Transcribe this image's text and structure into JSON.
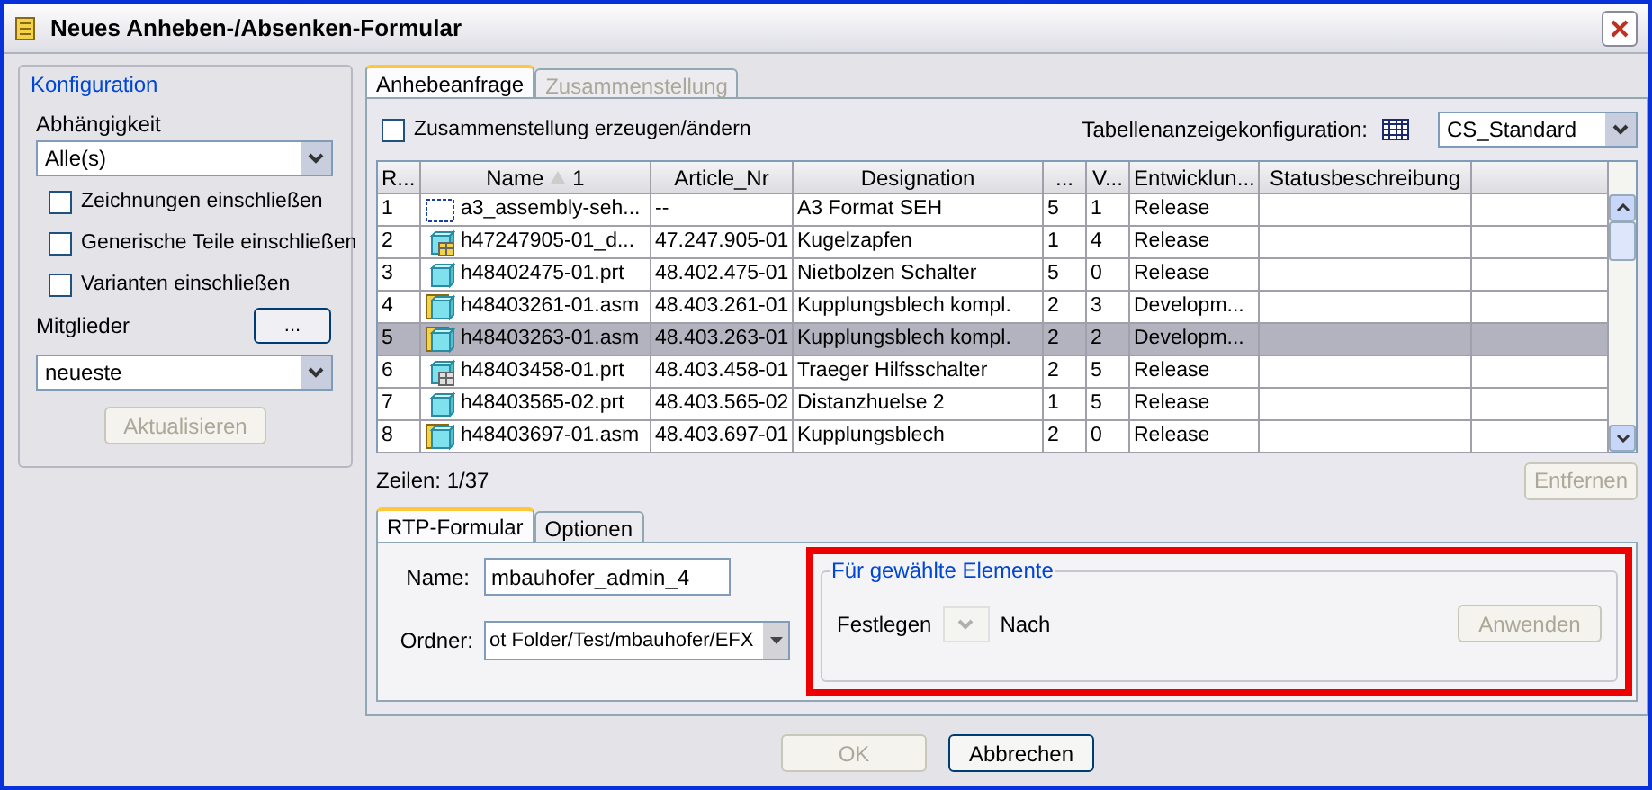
{
  "window": {
    "title": "Neues Anheben-/Absenken-Formular"
  },
  "configuration": {
    "title": "Konfiguration",
    "dependency_label": "Abhängigkeit",
    "dependency": "Alle(s)",
    "options": [
      {
        "label": "Zeichnungen einschließen",
        "checked": false
      },
      {
        "label": "Generische Teile einschließen",
        "checked": false
      },
      {
        "label": "Varianten einschließen",
        "checked": false
      }
    ],
    "members_label": "Mitglieder",
    "members_button": "...",
    "members": "neueste",
    "refresh_button": {
      "label": "Aktualisieren",
      "disabled": true
    }
  },
  "tabs": [
    {
      "label": "Anhebeanfrage",
      "selected": true,
      "disabled": false
    },
    {
      "label": "Zusammenstellung",
      "selected": false,
      "disabled": true
    }
  ],
  "create_assembly": {
    "label": "Zusammenstellung erzeugen/ändern",
    "checked": false
  },
  "table_config": {
    "label": "Tabellenanzeigekonfiguration:",
    "value": "CS_Standard"
  },
  "table": {
    "columns": [
      {
        "label": "R..."
      },
      {
        "label": "Name",
        "sort": "1"
      },
      {
        "label": "Article_Nr"
      },
      {
        "label": "Designation"
      },
      {
        "label": "..."
      },
      {
        "label": "V..."
      },
      {
        "label": "Entwicklun..."
      },
      {
        "label": "Statusbeschreibung"
      }
    ],
    "rows": [
      {
        "kind": "layout",
        "selected": false,
        "cells": [
          "1",
          "a3_assembly-seh...",
          "--",
          "A3 Format SEH",
          "5",
          "1",
          "Release"
        ]
      },
      {
        "kind": "assembly-drawing",
        "selected": false,
        "cells": [
          "2",
          "h47247905-01_d...",
          "47.247.905-01",
          "Kugelzapfen",
          "1",
          "4",
          "Release"
        ]
      },
      {
        "kind": "part",
        "selected": false,
        "cells": [
          "3",
          "h48402475-01.prt",
          "48.402.475-01",
          "Nietbolzen Schalter",
          "5",
          "0",
          "Release"
        ]
      },
      {
        "kind": "assembly",
        "selected": false,
        "cells": [
          "4",
          "h48403261-01.asm",
          "48.403.261-01",
          "Kupplungsblech kompl.",
          "2",
          "3",
          "Developm..."
        ]
      },
      {
        "kind": "assembly",
        "selected": true,
        "cells": [
          "5",
          "h48403263-01.asm",
          "48.403.263-01",
          "Kupplungsblech kompl.",
          "2",
          "2",
          "Developm..."
        ]
      },
      {
        "kind": "drawing",
        "selected": false,
        "cells": [
          "6",
          "h48403458-01.prt",
          "48.403.458-01",
          "Traeger Hilfsschalter",
          "2",
          "5",
          "Release"
        ]
      },
      {
        "kind": "part",
        "selected": false,
        "cells": [
          "7",
          "h48403565-02.prt",
          "48.403.565-02",
          "Distanzhuelse 2",
          "1",
          "5",
          "Release"
        ]
      },
      {
        "kind": "assembly",
        "selected": false,
        "cells": [
          "8",
          "h48403697-01.asm",
          "48.403.697-01",
          "Kupplungsblech",
          "2",
          "0",
          "Release"
        ]
      }
    ]
  },
  "row_count": "Zeilen: 1/37",
  "remove_button": {
    "label": "Entfernen",
    "disabled": true
  },
  "form_tabs": [
    {
      "label": "RTP-Formular",
      "selected": true
    },
    {
      "label": "Optionen",
      "selected": false
    }
  ],
  "form": {
    "name_label": "Name:",
    "name": "mbauhofer_admin_4",
    "folder_label": "Ordner:",
    "folder": "ot Folder/Test/mbauhofer/EFX"
  },
  "selection_group": {
    "title": "Für gewählte Elemente",
    "highlighted": true,
    "set_label": "Festlegen",
    "to_label": "Nach",
    "apply_button": {
      "label": "Anwenden",
      "disabled": true
    }
  },
  "buttons": [
    {
      "label": "OK",
      "disabled": true
    },
    {
      "label": "Abbrechen",
      "disabled": false
    }
  ]
}
